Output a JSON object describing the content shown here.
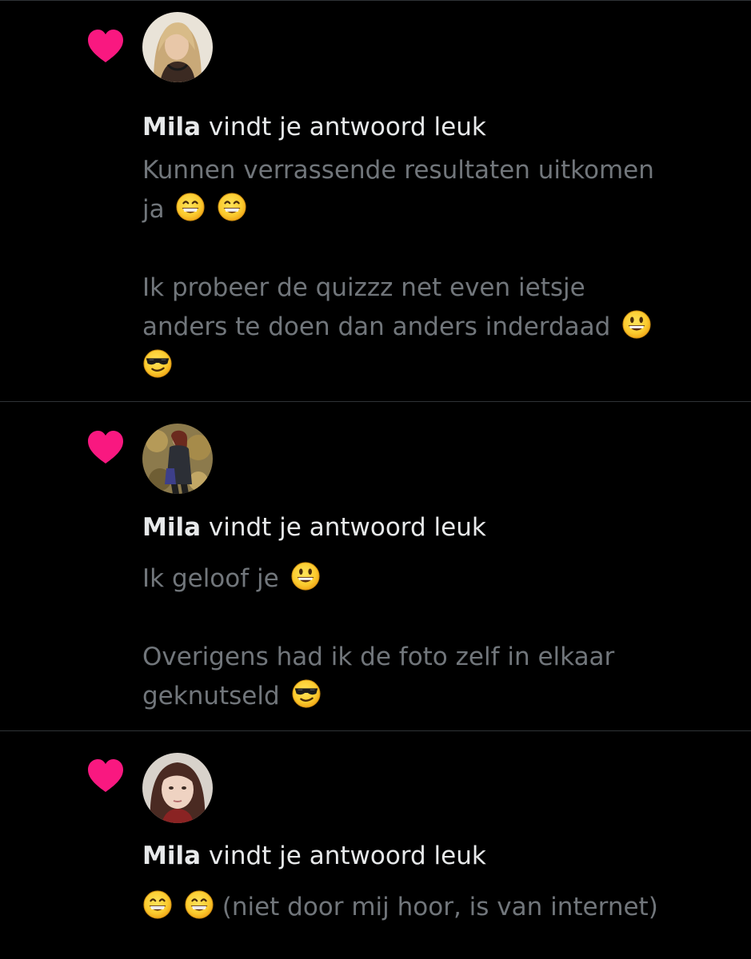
{
  "colors": {
    "background": "#000000",
    "heart": "#f91880",
    "headline_text": "#e7e9ea",
    "body_text": "#71767b",
    "divider": "#2f3336"
  },
  "notifications": [
    {
      "icon": "heart-icon",
      "user": "Mila",
      "action": "vindt je antwoord leuk",
      "text": {
        "p1_line1": "Kunnen verrassende resultaten uitkomen",
        "p1_line2": "ja",
        "p2_line1": "Ik probeer de quizzz net even ietsje",
        "p2_line2": "anders te doen dan anders inderdaad"
      },
      "emojis": [
        "grinning-face-icon",
        "grinning-face-icon",
        "smiling-face-icon",
        "sunglasses-face-icon"
      ]
    },
    {
      "icon": "heart-icon",
      "user": "Mila",
      "action": "vindt je antwoord leuk",
      "text": {
        "p1_line1": "Ik geloof je",
        "p2_line1": "Overigens had ik de foto zelf in elkaar",
        "p2_line2": "geknutseld"
      },
      "emojis": [
        "smiling-face-icon",
        "sunglasses-face-icon"
      ]
    },
    {
      "icon": "heart-icon",
      "user": "Mila",
      "action": "vindt je antwoord leuk",
      "text": {
        "p1_line1": "(niet door mij hoor, is van internet)"
      },
      "emojis": [
        "grinning-face-icon",
        "grinning-face-icon"
      ]
    }
  ]
}
